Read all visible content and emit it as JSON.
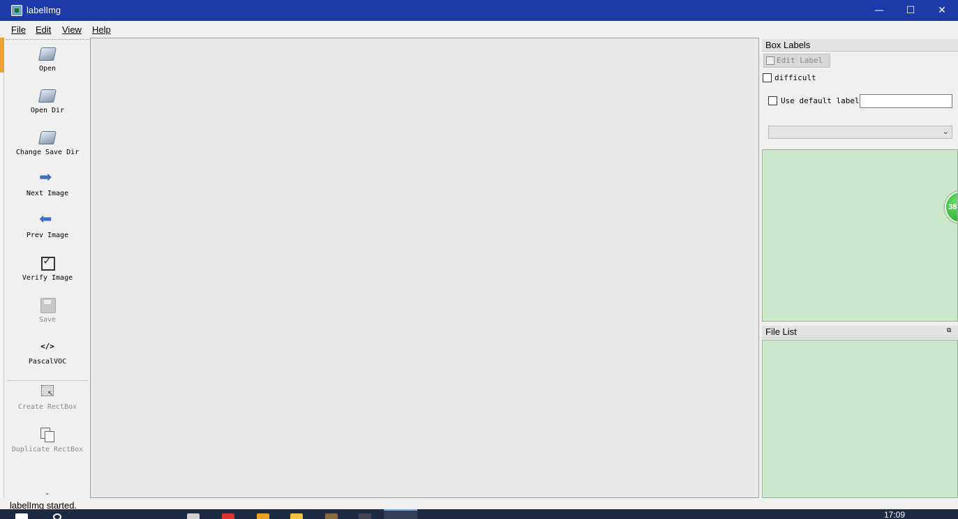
{
  "window": {
    "title": "labelImg"
  },
  "menu": {
    "items": [
      "File",
      "Edit",
      "View",
      "Help"
    ]
  },
  "toolbar": {
    "tools": [
      {
        "label": "Open",
        "icon": "folder-icon",
        "enabled": true
      },
      {
        "label": "Open Dir",
        "icon": "folder-icon",
        "enabled": true
      },
      {
        "label": "Change Save Dir",
        "icon": "folder-icon",
        "enabled": true
      },
      {
        "label": "Next Image",
        "icon": "arrow-right-icon",
        "enabled": true
      },
      {
        "label": "Prev Image",
        "icon": "arrow-left-icon",
        "enabled": true
      },
      {
        "label": "Verify Image",
        "icon": "verify-icon",
        "enabled": true
      },
      {
        "label": "Save",
        "icon": "save-icon",
        "enabled": false
      },
      {
        "label": "PascalVOC",
        "icon": "code-icon",
        "glyph": "</>",
        "enabled": true
      },
      {
        "label": "Create RectBox",
        "icon": "rect-icon",
        "enabled": false
      },
      {
        "label": "Duplicate RectBox",
        "icon": "dup-icon",
        "enabled": false
      }
    ],
    "more_glyph": "⌄"
  },
  "box_labels": {
    "title": "Box Labels",
    "edit_label_button": "Edit Label",
    "difficult_label": "difficult",
    "use_default_label": "Use default label",
    "default_label_value": "",
    "combo_value": "",
    "overlay_badge": "38"
  },
  "file_list": {
    "title": "File List"
  },
  "status": {
    "text": "labelImg started."
  },
  "taskbar": {
    "clock": "17:09"
  },
  "colors": {
    "titlebar": "#1e3aa8",
    "list_background": "#cce8cc",
    "canvas": "#e8e8e8"
  }
}
